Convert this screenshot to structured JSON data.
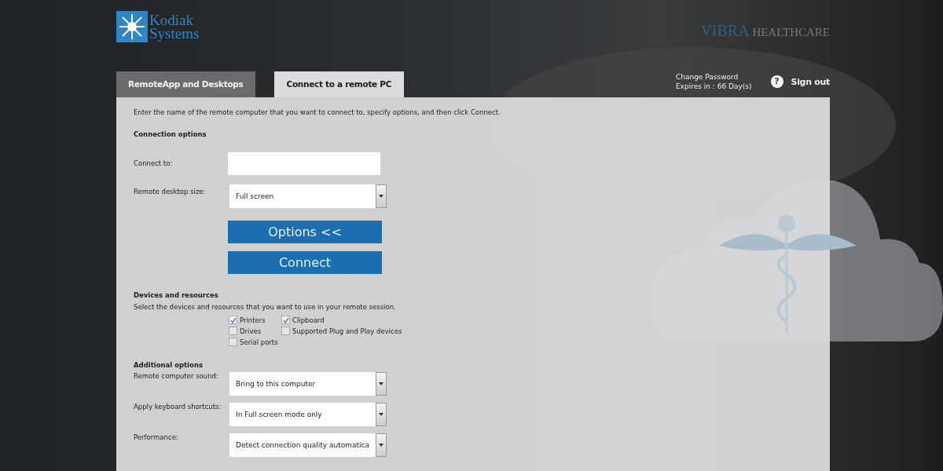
{
  "header": {
    "logo_text": [
      "Kodiak",
      "Systems"
    ],
    "partner_logo": {
      "first": "VIBRA",
      "rest": " HEALTHCARE"
    }
  },
  "tabs": [
    {
      "label": "RemoteApp and Desktops",
      "selected": false
    },
    {
      "label": "Connect to a remote PC",
      "selected": true
    }
  ],
  "account": {
    "password_notice": [
      "Change Password",
      "Expires in : 66 Day(s)"
    ],
    "help": "?",
    "sign_out": "Sign out"
  },
  "intro": "Enter the name of the remote computer that you want to connect to, specify options, and then click Connect.",
  "connection_options": {
    "heading": "Connection options",
    "connect_to": {
      "label": "Connect to:"
    },
    "desktop_size": {
      "label": "Remote desktop size:",
      "value": "Full screen"
    }
  },
  "buttons": [
    {
      "label": "Options <<"
    },
    {
      "label": "Connect"
    }
  ],
  "devices": {
    "heading": "Devices and resources",
    "description": "Select the devices and resources that you want to use in your remote session.",
    "items": [
      {
        "label": "Printers",
        "checked": true
      },
      {
        "label": "Clipboard",
        "checked": true
      },
      {
        "label": "Drives",
        "checked": false
      },
      {
        "label": "Supported Plug and Play devices",
        "checked": false
      },
      {
        "label": "Serial ports",
        "checked": false
      }
    ]
  },
  "additional_options": {
    "heading": "Additional options",
    "fields": [
      {
        "label": "Remote computer sound:",
        "value": "Bring to this computer"
      },
      {
        "label": "Apply keyboard shortcuts:",
        "value": "In Full screen mode only"
      },
      {
        "label": "Performance:",
        "value": "Detect connection quality automatica"
      }
    ]
  }
}
